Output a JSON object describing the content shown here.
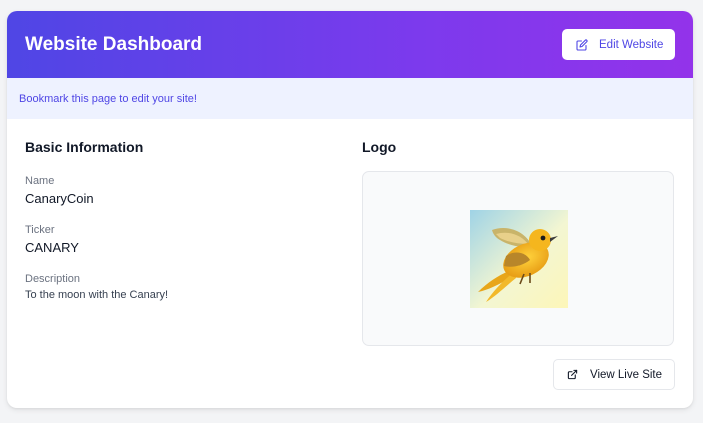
{
  "header": {
    "title": "Website Dashboard",
    "edit_button_label": "Edit Website",
    "edit_icon": "edit-icon"
  },
  "notice": {
    "text": "Bookmark this page to edit your site!"
  },
  "basic_info": {
    "title": "Basic Information",
    "name_label": "Name",
    "name_value": "CanaryCoin",
    "ticker_label": "Ticker",
    "ticker_value": "CANARY",
    "description_label": "Description",
    "description_value": "To the moon with the Canary!"
  },
  "logo": {
    "title": "Logo",
    "image": "canary-bird-logo"
  },
  "actions": {
    "view_live_label": "View Live Site",
    "view_live_icon": "external-link-icon"
  },
  "colors": {
    "gradient_start": "#4f46e5",
    "gradient_end": "#9333ea",
    "accent": "#4f46e5",
    "notice_bg": "#eef2ff"
  }
}
